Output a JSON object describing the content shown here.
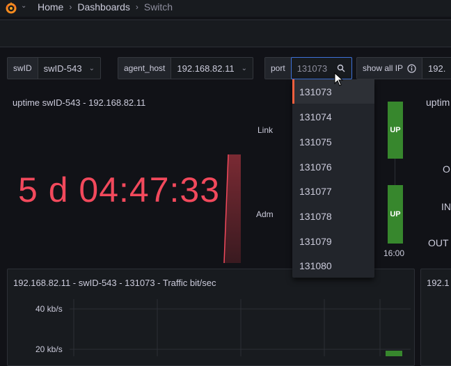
{
  "header": {
    "breadcrumbs": [
      "Home",
      "Dashboards",
      "Switch"
    ]
  },
  "variables": {
    "swid": {
      "label": "swID",
      "value": "swID-543"
    },
    "agent_host": {
      "label": "agent_host",
      "value": "192.168.82.11"
    },
    "port": {
      "label": "port",
      "placeholder": "131073"
    },
    "show_all_ip": {
      "label": "show all IP",
      "value": "192."
    }
  },
  "port_dropdown": {
    "options": [
      "131073",
      "131074",
      "131075",
      "131076",
      "131077",
      "131078",
      "131079",
      "131080"
    ],
    "selected_index": 0
  },
  "uptime_panel": {
    "title": "uptime swID-543 - 192.168.82.11",
    "value": "5 d 04:47:33"
  },
  "status_panel": {
    "link_label": "Link",
    "adm_label": "Adm",
    "link_state": "UP",
    "adm_state": "UP",
    "time_label": "16:00"
  },
  "right_panel": {
    "title": "uptim",
    "rows": [
      "O",
      "IN",
      "OUT"
    ]
  },
  "traffic_panel": {
    "title": "192.168.82.11 - swID-543 - 131073 - Traffic bit/sec",
    "y_ticks": [
      "40 kb/s",
      "20 kb/s"
    ]
  },
  "traffic_panel_right": {
    "title": "192.1"
  },
  "colors": {
    "background": "#111217",
    "panel": "#181b1f",
    "uptime_value": "#f2495c",
    "up_state": "#37872d",
    "accent_focus": "#3d71d9",
    "active_option": "#f55f3e"
  }
}
